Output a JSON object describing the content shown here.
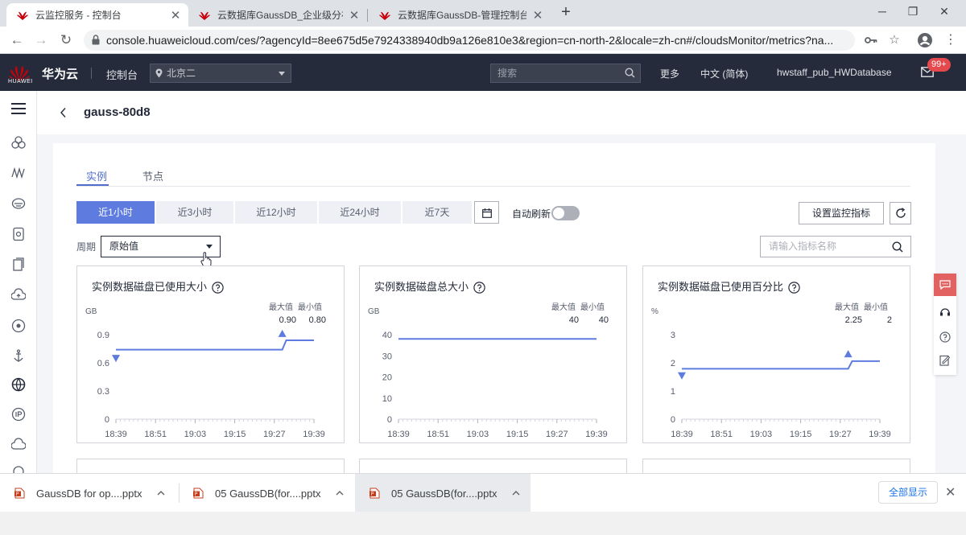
{
  "browser": {
    "tabs": [
      {
        "label": "云监控服务 - 控制台",
        "active": true
      },
      {
        "label": "云数据库GaussDB_企业级分布式",
        "active": false
      },
      {
        "label": "云数据库GaussDB-管理控制台",
        "active": false
      }
    ],
    "new_tab": "+",
    "url": "console.huaweicloud.com/ces/?agencyId=8ee675d5e7924338940db9a126e810e3&region=cn-north-2&locale=zh-cn#/cloudsMonitor/metrics?na..."
  },
  "header": {
    "logo_text": "HUAWEI",
    "brand": "华为云",
    "console": "控制台",
    "region": "北京二",
    "search_placeholder": "搜索",
    "more": "更多",
    "language": "中文 (简体)",
    "user": "hwstaff_pub_HWDatabase",
    "badge": "99+"
  },
  "page": {
    "title": "gauss-80d8",
    "subtabs": [
      "实例",
      "节点"
    ],
    "time_ranges": [
      "近1小时",
      "近3小时",
      "近12小时",
      "近24小时",
      "近7天"
    ],
    "auto_refresh_label": "自动刷新",
    "set_metrics_button": "设置监控指标",
    "period_label": "周期",
    "period_value": "原始值",
    "metric_search_placeholder": "请输入指标名称"
  },
  "colors": {
    "accent": "#5e7ce0",
    "line": "#5e7ce0",
    "header_bg": "#252b3a",
    "logo_red": "#c7000b"
  },
  "legend": {
    "max_label": "最大值",
    "min_label": "最小值"
  },
  "chart_data": [
    {
      "type": "line",
      "title": "实例数据磁盘已使用大小",
      "ylabel": "GB",
      "yticks": [
        0,
        0.3,
        0.6,
        0.9
      ],
      "ylim": [
        0,
        0.9
      ],
      "x": [
        "18:39",
        "18:51",
        "19:03",
        "19:15",
        "19:27",
        "19:39"
      ],
      "series": [
        {
          "points": [
            [
              0,
              0.74
            ],
            [
              0.84,
              0.74
            ],
            [
              0.86,
              0.84
            ],
            [
              1.0,
              0.84
            ]
          ]
        }
      ],
      "max": "0.90",
      "min": "0.80",
      "max_mark": [
        0.84,
        0.91
      ],
      "min_mark": [
        0.0,
        0.65
      ]
    },
    {
      "type": "line",
      "title": "实例数据磁盘总大小",
      "ylabel": "GB",
      "yticks": [
        0,
        10,
        20,
        30,
        40
      ],
      "ylim": [
        0,
        40
      ],
      "x": [
        "18:39",
        "18:51",
        "19:03",
        "19:15",
        "19:27",
        "19:39"
      ],
      "series": [
        {
          "points": [
            [
              0,
              38
            ],
            [
              1.0,
              38
            ]
          ]
        }
      ],
      "max": "40",
      "min": "40"
    },
    {
      "type": "line",
      "title": "实例数据磁盘已使用百分比",
      "ylabel": "%",
      "yticks": [
        0,
        1,
        2,
        3
      ],
      "ylim": [
        0,
        3
      ],
      "x": [
        "18:39",
        "18:51",
        "19:03",
        "19:15",
        "19:27",
        "19:39"
      ],
      "series": [
        {
          "points": [
            [
              0,
              1.79
            ],
            [
              0.84,
              1.79
            ],
            [
              0.86,
              2.06
            ],
            [
              1.0,
              2.06
            ]
          ]
        }
      ],
      "max": "2.25",
      "min": "2",
      "max_mark": [
        0.84,
        2.31
      ],
      "min_mark": [
        0.0,
        1.55
      ]
    }
  ],
  "downloads": [
    {
      "name": "GaussDB for op....pptx"
    },
    {
      "name": "05 GaussDB(for....pptx"
    },
    {
      "name": "05 GaussDB(for....pptx"
    }
  ],
  "show_all": "全部显示"
}
